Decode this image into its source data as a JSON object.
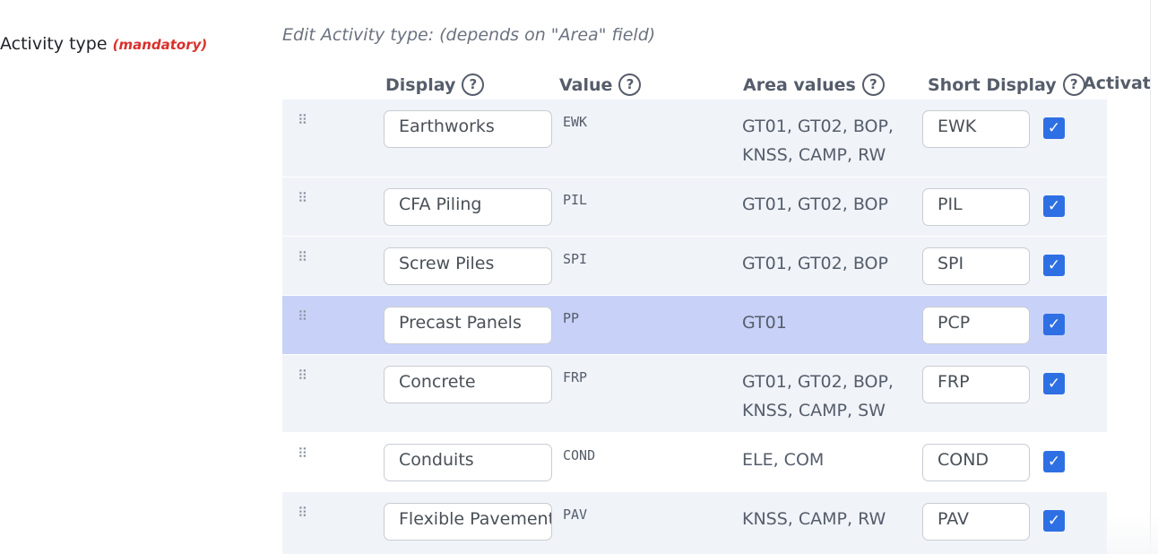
{
  "field": {
    "label": "Activity type",
    "mandatory": "(mandatory)",
    "hint": "Edit Activity type: (depends on \"Area\" field)"
  },
  "columns": {
    "display": "Display",
    "value": "Value",
    "area": "Area values",
    "short": "Short Display",
    "activated": "Activated"
  },
  "icons": {
    "help": "?",
    "drag": "⠿",
    "check": "✓"
  },
  "rows": [
    {
      "display": "Earthworks",
      "value": "EWK",
      "area": "GT01, GT02, BOP, KNSS, CAMP, RW",
      "short": "EWK",
      "activated": true
    },
    {
      "display": "CFA Piling",
      "value": "PIL",
      "area": "GT01, GT02, BOP",
      "short": "PIL",
      "activated": true
    },
    {
      "display": "Screw Piles",
      "value": "SPI",
      "area": "GT01, GT02, BOP",
      "short": "SPI",
      "activated": true
    },
    {
      "display": "Precast Panels",
      "value": "PP",
      "area": "GT01",
      "short": "PCP",
      "activated": true
    },
    {
      "display": "Concrete",
      "value": "FRP",
      "area": "GT01, GT02, BOP, KNSS, CAMP, SW",
      "short": "FRP",
      "activated": true
    },
    {
      "display": "Conduits",
      "value": "COND",
      "area": "ELE, COM",
      "short": "COND",
      "activated": true
    },
    {
      "display": "Flexible Pavement",
      "value": "PAV",
      "area": "KNSS, CAMP, RW",
      "short": "PAV",
      "activated": true
    }
  ],
  "colors": {
    "row_alt": "#f0f3f8",
    "row_highlight": "#c8d2f8",
    "checkbox": "#2f6fe4",
    "mandatory": "#d9302c"
  }
}
